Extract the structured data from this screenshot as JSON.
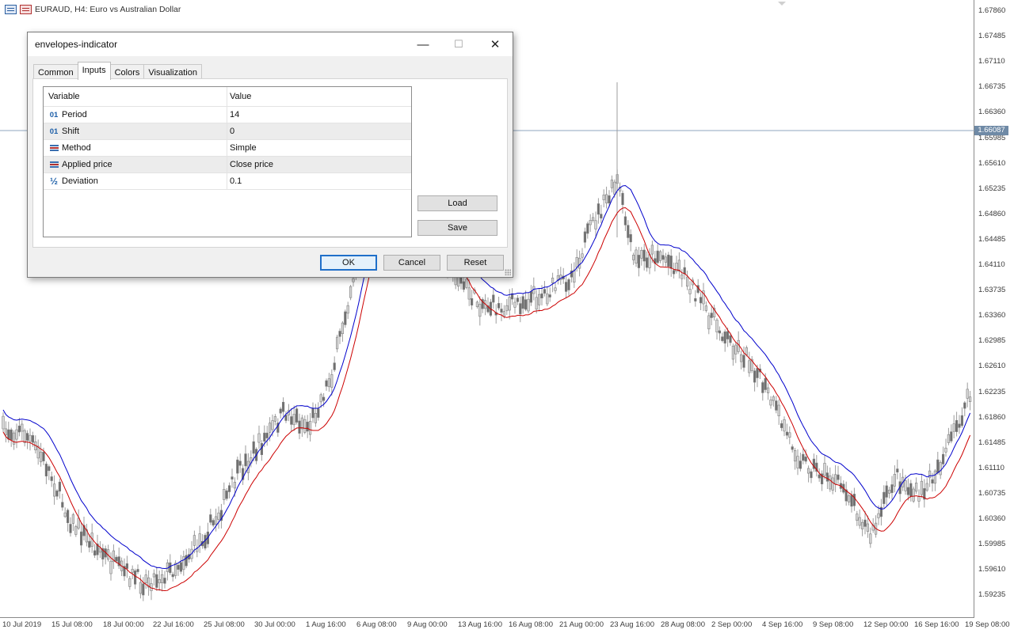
{
  "chart": {
    "symbol_text": "EURAUD, H4:  Euro vs Australian Dollar",
    "current_price_label": "1.66087",
    "y_ticks": [
      "1.67860",
      "1.67485",
      "1.67110",
      "1.66735",
      "1.66360",
      "1.65985",
      "1.65610",
      "1.65235",
      "1.64860",
      "1.64485",
      "1.64110",
      "1.63735",
      "1.63360",
      "1.62985",
      "1.62610",
      "1.62235",
      "1.61860",
      "1.61485",
      "1.61110",
      "1.60735",
      "1.60360",
      "1.59985",
      "1.59610",
      "1.59235"
    ],
    "x_ticks": [
      "10 Jul 2019",
      "15 Jul 08:00",
      "18 Jul 00:00",
      "22 Jul 16:00",
      "25 Jul 08:00",
      "30 Jul 00:00",
      "1 Aug 16:00",
      "6 Aug 08:00",
      "9 Aug 00:00",
      "13 Aug 16:00",
      "16 Aug 08:00",
      "21 Aug 00:00",
      "23 Aug 16:00",
      "28 Aug 08:00",
      "2 Sep 00:00",
      "4 Sep 16:00",
      "9 Sep 08:00",
      "12 Sep 00:00",
      "16 Sep 16:00",
      "19 Sep 08:00"
    ],
    "colors": {
      "upper_envelope": "#0000cc",
      "lower_envelope": "#cc0000",
      "candles": "#7f7f7f",
      "price_line": "#6f8aa6"
    }
  },
  "dialog": {
    "title": "envelopes-indicator",
    "tabs": [
      "Common",
      "Inputs",
      "Colors",
      "Visualization"
    ],
    "active_tab": "Inputs",
    "grid": {
      "headers": [
        "Variable",
        "Value"
      ],
      "rows": [
        {
          "icon": "01",
          "variable": "Period",
          "value": "14"
        },
        {
          "icon": "01",
          "variable": "Shift",
          "value": "0"
        },
        {
          "icon": "enum-icon",
          "variable": "Method",
          "value": "Simple"
        },
        {
          "icon": "enum-icon",
          "variable": "Applied price",
          "value": "Close price"
        },
        {
          "icon": "½",
          "variable": "Deviation",
          "value": "0.1"
        }
      ]
    },
    "buttons": {
      "load": "Load",
      "save": "Save",
      "ok": "OK",
      "cancel": "Cancel",
      "reset": "Reset"
    },
    "window_controls": {
      "minimize": "—",
      "maximize": "☐",
      "close": "✕"
    }
  }
}
